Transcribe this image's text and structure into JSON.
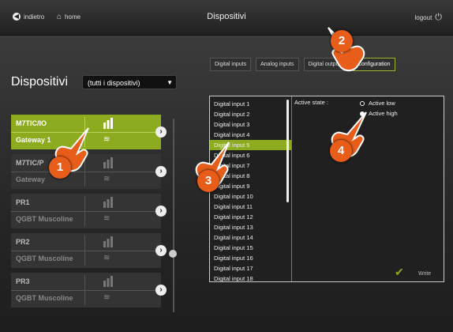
{
  "header": {
    "back_label": "indietro",
    "home_label": "home",
    "title": "Dispositivi",
    "logout_label": "logout"
  },
  "tabs": [
    {
      "label": "Digital inputs",
      "active": false
    },
    {
      "label": "Analog inputs",
      "active": false
    },
    {
      "label": "Digital outputs",
      "active": false
    },
    {
      "label": "Configuration",
      "active": true
    }
  ],
  "sidebar": {
    "title": "Dispositivi",
    "filter_value": "(tutti i dispositivi)"
  },
  "devices": [
    {
      "name": "M7TIC/IO",
      "sub": "Gateway 1",
      "selected": true
    },
    {
      "name": "M7TIC/P",
      "sub": "Gateway",
      "selected": false
    },
    {
      "name": "PR1",
      "sub": "QGBT Muscoline",
      "selected": false
    },
    {
      "name": "PR2",
      "sub": "QGBT Muscoline",
      "selected": false
    },
    {
      "name": "PR3",
      "sub": "QGBT Muscoline",
      "selected": false
    }
  ],
  "inputs": [
    "Digital input 1",
    "Digital input 2",
    "Digital input 3",
    "Digital input 4",
    "Digital input 5",
    "Digital input 6",
    "Digital input 7",
    "Digital input 8",
    "Digital input 9",
    "Digital input 10",
    "Digital input 11",
    "Digital input 12",
    "Digital input 13",
    "Digital input 14",
    "Digital input 15",
    "Digital input 16",
    "Digital input 17",
    "Digital input 18"
  ],
  "selected_input": "Digital input 5",
  "config": {
    "active_state_label": "Active state :",
    "option_low": "Active low",
    "option_high": "Active high",
    "selected": "Active low",
    "write_label": "Write"
  },
  "callouts": [
    "1",
    "2",
    "3",
    "4"
  ],
  "colors": {
    "accent": "#8dab1f",
    "callout": "#e85d1a"
  }
}
